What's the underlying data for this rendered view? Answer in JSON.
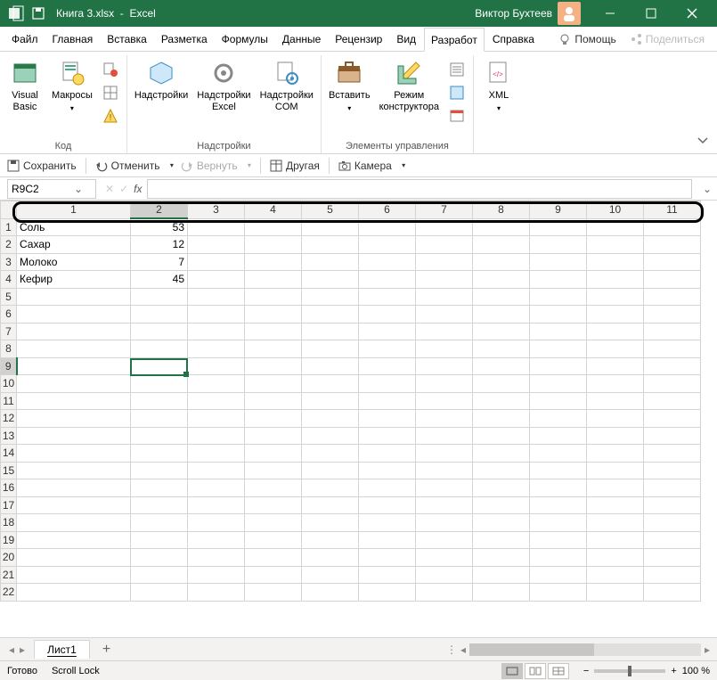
{
  "titlebar": {
    "filename": "Книга 3.xlsx",
    "appname": "Excel",
    "username": "Виктор Бухтеев"
  },
  "tabs": {
    "file": "Файл",
    "home": "Главная",
    "insert": "Вставка",
    "layout": "Разметка",
    "formulas": "Формулы",
    "data": "Данные",
    "review": "Рецензир",
    "view": "Вид",
    "developer": "Разработ",
    "help": "Справка",
    "help_btn": "Помощь",
    "share": "Поделиться"
  },
  "ribbon": {
    "vb": "Visual\nBasic",
    "macros": "Макросы",
    "code_group": "Код",
    "addins": "Надстройки",
    "excel_addins": "Надстройки\nExcel",
    "com_addins": "Надстройки\nCOM",
    "addins_group": "Надстройки",
    "insert": "Вставить",
    "design": "Режим\nконструктора",
    "controls_group": "Элементы управления",
    "xml": "XML"
  },
  "qat": {
    "save": "Сохранить",
    "undo": "Отменить",
    "redo": "Вернуть",
    "other": "Другая",
    "camera": "Камера"
  },
  "formula": {
    "namebox": "R9C2"
  },
  "columns": [
    "1",
    "2",
    "3",
    "4",
    "5",
    "6",
    "7",
    "8",
    "9",
    "10",
    "11"
  ],
  "rows": [
    "1",
    "2",
    "3",
    "4",
    "5",
    "6",
    "7",
    "8",
    "9",
    "10",
    "11",
    "12",
    "13",
    "14",
    "15",
    "16",
    "17",
    "18",
    "19",
    "20",
    "21",
    "22"
  ],
  "cells": {
    "A1": "Соль",
    "B1": "53",
    "A2": "Сахар",
    "B2": "12",
    "A3": "Молоко",
    "B3": "7",
    "A4": "Кефир",
    "B4": "45"
  },
  "chart_data": {
    "type": "table",
    "categories": [
      "Соль",
      "Сахар",
      "Молоко",
      "Кефир"
    ],
    "values": [
      53,
      12,
      7,
      45
    ]
  },
  "sheet_tab": "Лист1",
  "status": {
    "ready": "Готово",
    "scroll": "Scroll Lock",
    "zoom": "100 %"
  }
}
